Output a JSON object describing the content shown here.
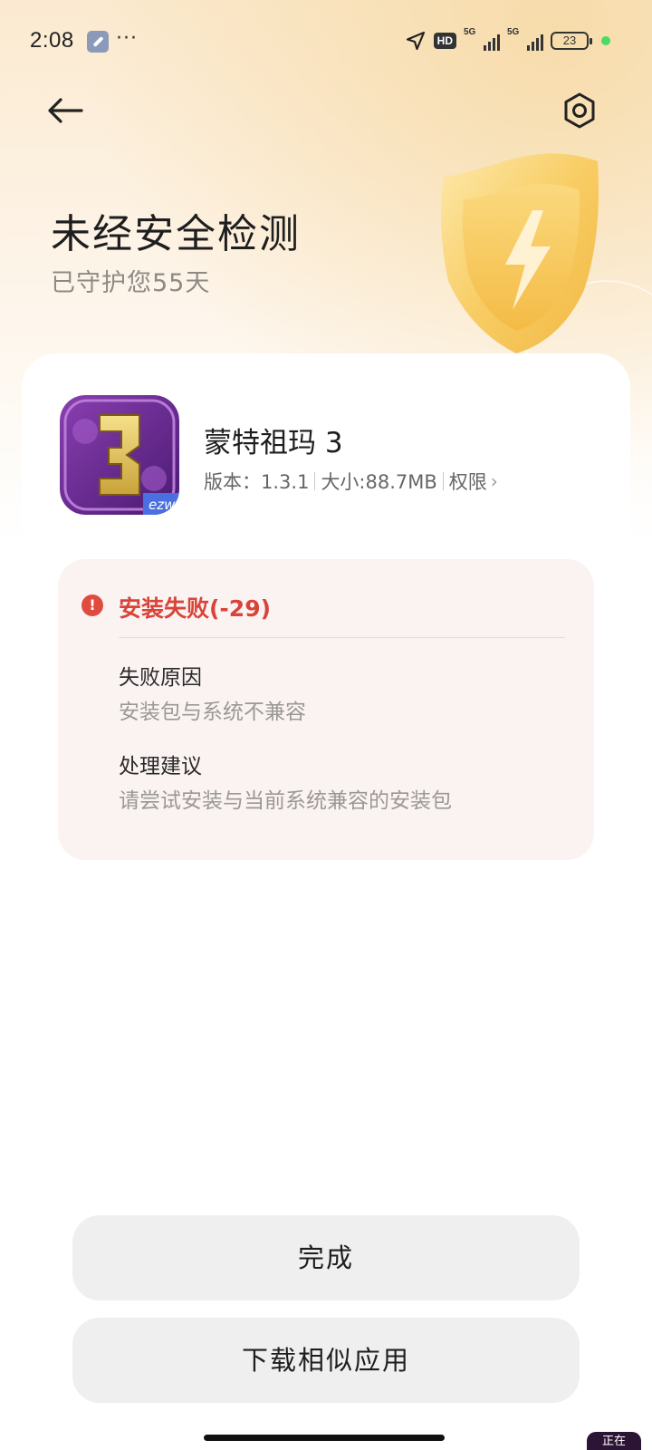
{
  "status_bar": {
    "time": "2:08",
    "more": "···",
    "hd": "HD",
    "signal1_label": "5G",
    "signal2_label": "5G",
    "battery": "23"
  },
  "header": {
    "title": "未经安全检测",
    "subtitle": "已守护您55天"
  },
  "app": {
    "name": "蒙特祖玛 3",
    "version": "版本：1.3.1",
    "size": "大小:88.7MB",
    "permissions": "权限",
    "icon_badge": "ezw"
  },
  "error": {
    "title": "安装失败(-29)",
    "reason_label": "失败原因",
    "reason_value": "安装包与系统不兼容",
    "advice_label": "处理建议",
    "advice_value": "请尝试安装与当前系统兼容的安装包"
  },
  "buttons": {
    "done": "完成",
    "similar": "下载相似应用"
  },
  "floating": {
    "label": "正在"
  },
  "colors": {
    "error": "#d9443a",
    "button_bg": "#efefef",
    "hero_gold": "#f5c45a"
  }
}
